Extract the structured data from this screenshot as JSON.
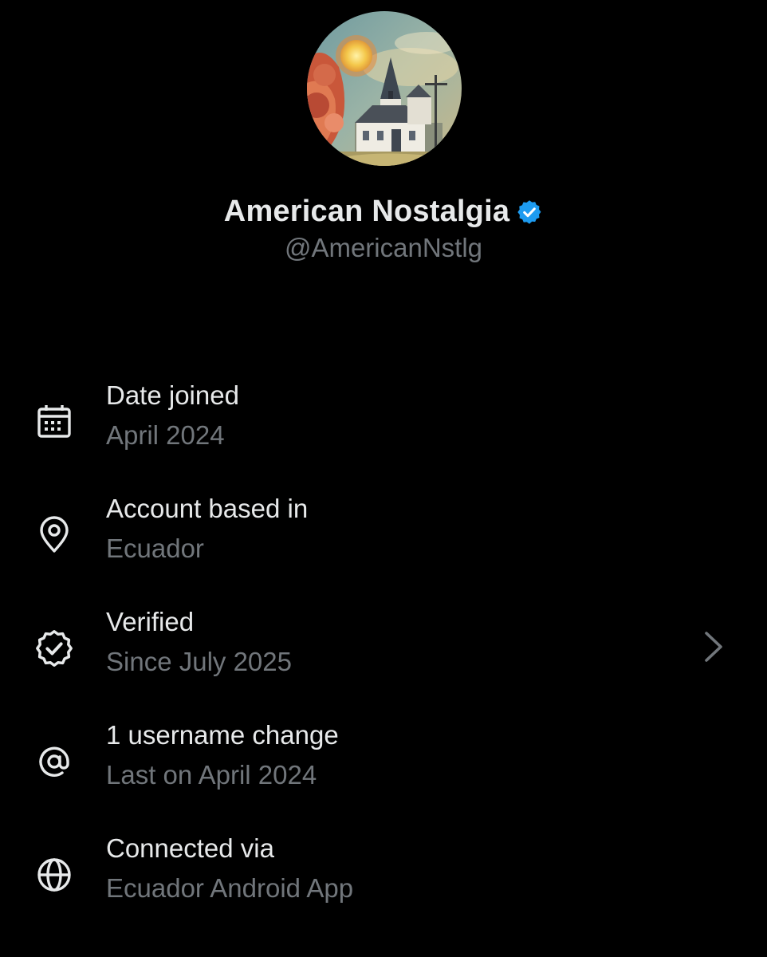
{
  "profile": {
    "display_name": "American Nostalgia",
    "handle": "@AmericanNstlg",
    "verified": true,
    "badge_color": "#1d9bf0",
    "avatar": "painted-church-landscape"
  },
  "info_items": [
    {
      "icon": "calendar-icon",
      "title": "Date joined",
      "value": "April 2024"
    },
    {
      "icon": "location-pin-icon",
      "title": "Account based in",
      "value": "Ecuador"
    },
    {
      "icon": "verified-badge-icon",
      "title": "Verified",
      "value": "Since July 2025",
      "has_chevron": true
    },
    {
      "icon": "at-sign-icon",
      "title": "1 username change",
      "value": "Last on April 2024"
    },
    {
      "icon": "globe-icon",
      "title": "Connected via",
      "value": "Ecuador Android App"
    }
  ],
  "colors": {
    "background": "#000000",
    "primary_text": "#e7e9ea",
    "secondary_text": "#71767b",
    "accent": "#1d9bf0"
  }
}
